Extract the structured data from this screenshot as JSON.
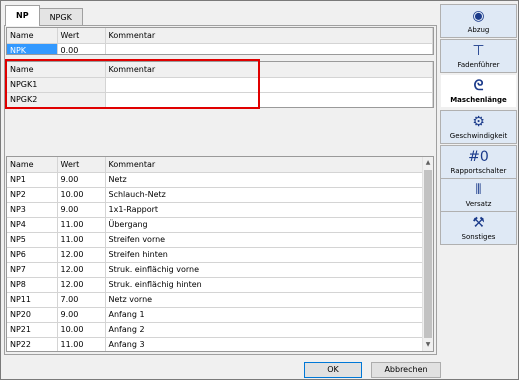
{
  "tabs": [
    {
      "label": "NP",
      "active": true
    },
    {
      "label": "NPGK",
      "active": false
    }
  ],
  "top_grid": {
    "columns": [
      "Name",
      "Wert",
      "Kommentar"
    ],
    "rows": [
      {
        "name": "NPK",
        "wert": "0.00",
        "kommentar": ""
      }
    ]
  },
  "npgk_grid": {
    "columns": [
      "Name",
      "Kommentar"
    ],
    "rows": [
      {
        "name": "NPGK1",
        "kommentar": ""
      },
      {
        "name": "NPGK2",
        "kommentar": ""
      }
    ]
  },
  "np_table": {
    "columns": [
      "Name",
      "Wert",
      "Kommentar"
    ],
    "rows": [
      {
        "name": "NP1",
        "wert": "9.00",
        "kommentar": "Netz"
      },
      {
        "name": "NP2",
        "wert": "10.00",
        "kommentar": "Schlauch-Netz"
      },
      {
        "name": "NP3",
        "wert": "9.00",
        "kommentar": "1x1-Rapport"
      },
      {
        "name": "NP4",
        "wert": "11.00",
        "kommentar": "Übergang"
      },
      {
        "name": "NP5",
        "wert": "11.00",
        "kommentar": "Streifen vorne"
      },
      {
        "name": "NP6",
        "wert": "12.00",
        "kommentar": "Streifen hinten"
      },
      {
        "name": "NP7",
        "wert": "12.00",
        "kommentar": "Struk. einflächig vorne"
      },
      {
        "name": "NP8",
        "wert": "12.00",
        "kommentar": "Struk. einflächig hinten"
      },
      {
        "name": "NP11",
        "wert": "7.00",
        "kommentar": "Netz vorne"
      },
      {
        "name": "NP20",
        "wert": "9.00",
        "kommentar": "Anfang 1"
      },
      {
        "name": "NP21",
        "wert": "10.00",
        "kommentar": "Anfang 2"
      },
      {
        "name": "NP22",
        "wert": "11.00",
        "kommentar": "Anfang 3"
      }
    ]
  },
  "nav": [
    {
      "label": "Abzug",
      "icon": "abzug-icon",
      "glyph": "◉",
      "active": false
    },
    {
      "label": "Fadenführer",
      "icon": "fadenfuehrer-icon",
      "glyph": "⊤",
      "active": false
    },
    {
      "label": "Maschenlänge",
      "icon": "maschenlaenge-icon",
      "glyph": "ᘓ",
      "active": true
    },
    {
      "label": "Geschwindigkeit",
      "icon": "geschwindigkeit-icon",
      "glyph": "⚙",
      "active": false
    },
    {
      "label": "Rapportschalter",
      "icon": "rapportschalter-icon",
      "glyph": "#0",
      "active": false
    },
    {
      "label": "Versatz",
      "icon": "versatz-icon",
      "glyph": "⫴",
      "active": false
    },
    {
      "label": "Sonstiges",
      "icon": "sonstiges-icon",
      "glyph": "⚒",
      "active": false
    }
  ],
  "buttons": {
    "ok": "OK",
    "cancel": "Abbrechen"
  },
  "colors": {
    "selection": "#3399ff",
    "highlight_outline": "#e00000",
    "nav_bg": "#dfe9f5"
  }
}
